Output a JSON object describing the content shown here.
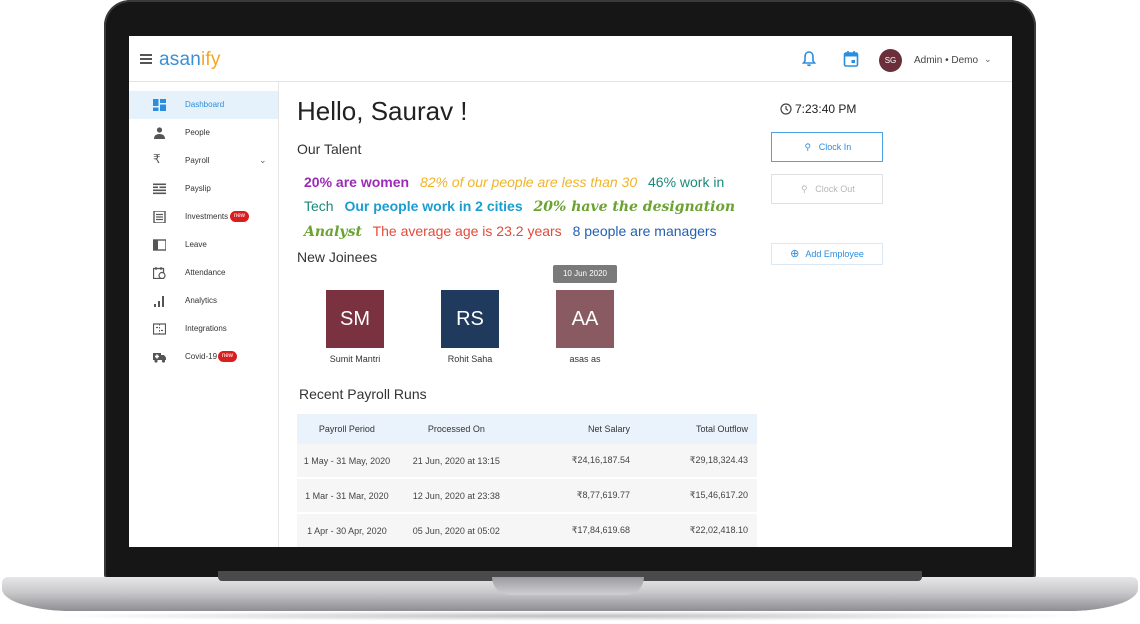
{
  "app": {
    "logo_main": "asan",
    "logo_accent": "ify"
  },
  "header": {
    "user_initials": "SG",
    "user_label": "Admin • Demo",
    "bell_icon": "bell-icon",
    "calendar_icon": "calendar-icon"
  },
  "sidebar": {
    "items": [
      {
        "label": "Dashboard",
        "icon": "dashboard-icon",
        "active": true
      },
      {
        "label": "People",
        "icon": "person-icon"
      },
      {
        "label": "Payroll",
        "icon": "rupee-icon"
      },
      {
        "label": "Payslip",
        "icon": "payslip-icon"
      },
      {
        "label": "Investments",
        "icon": "investments-icon",
        "badge": "new"
      },
      {
        "label": "Leave",
        "icon": "leave-icon"
      },
      {
        "label": "Attendance",
        "icon": "attendance-icon"
      },
      {
        "label": "Analytics",
        "icon": "analytics-icon"
      },
      {
        "label": "Integrations",
        "icon": "integrations-icon"
      },
      {
        "label": "Covid-19",
        "icon": "ambulance-icon",
        "badge": "new"
      }
    ]
  },
  "main": {
    "greeting": "Hello, Saurav !",
    "talent_heading": "Our Talent",
    "facts": [
      "20% are women",
      "82% of our people are less than 30",
      "46% work in Tech",
      "Our people work in 2 cities",
      "20% have the designation Analyst",
      "The average age is 23.2 years",
      "8 people are managers"
    ],
    "joinees_heading": "New Joinees",
    "joinee_tooltip": "10 Jun 2020",
    "joinees": [
      {
        "initials": "SM",
        "name": "Sumit Mantri",
        "color": "#7a3140"
      },
      {
        "initials": "RS",
        "name": "Rohit Saha",
        "color": "#1f3a5c"
      },
      {
        "initials": "AA",
        "name": "asas as",
        "color": "#8a5a62"
      }
    ],
    "payroll_heading": "Recent Payroll Runs",
    "payroll_columns": [
      "Payroll Period",
      "Processed On",
      "Net Salary",
      "Total Outflow"
    ],
    "payroll_rows": [
      [
        "1 May - 31 May, 2020",
        "21 Jun, 2020 at 13:15",
        "₹24,16,187.54",
        "₹29,18,324.43"
      ],
      [
        "1 Mar - 31 Mar, 2020",
        "12 Jun, 2020 at 23:38",
        "₹8,77,619.77",
        "₹15,46,617.20"
      ],
      [
        "1 Apr - 30 Apr, 2020",
        "05 Jun, 2020 at 05:02",
        "₹17,84,619.68",
        "₹22,02,418.10"
      ]
    ]
  },
  "right": {
    "time": "7:23:40 PM",
    "clock_in": "Clock In",
    "clock_out": "Clock Out",
    "add_employee": "Add Employee"
  },
  "colors": {
    "accent": "#2a8de0",
    "logo_accent": "#f5a623",
    "badge": "#d81e1e"
  }
}
